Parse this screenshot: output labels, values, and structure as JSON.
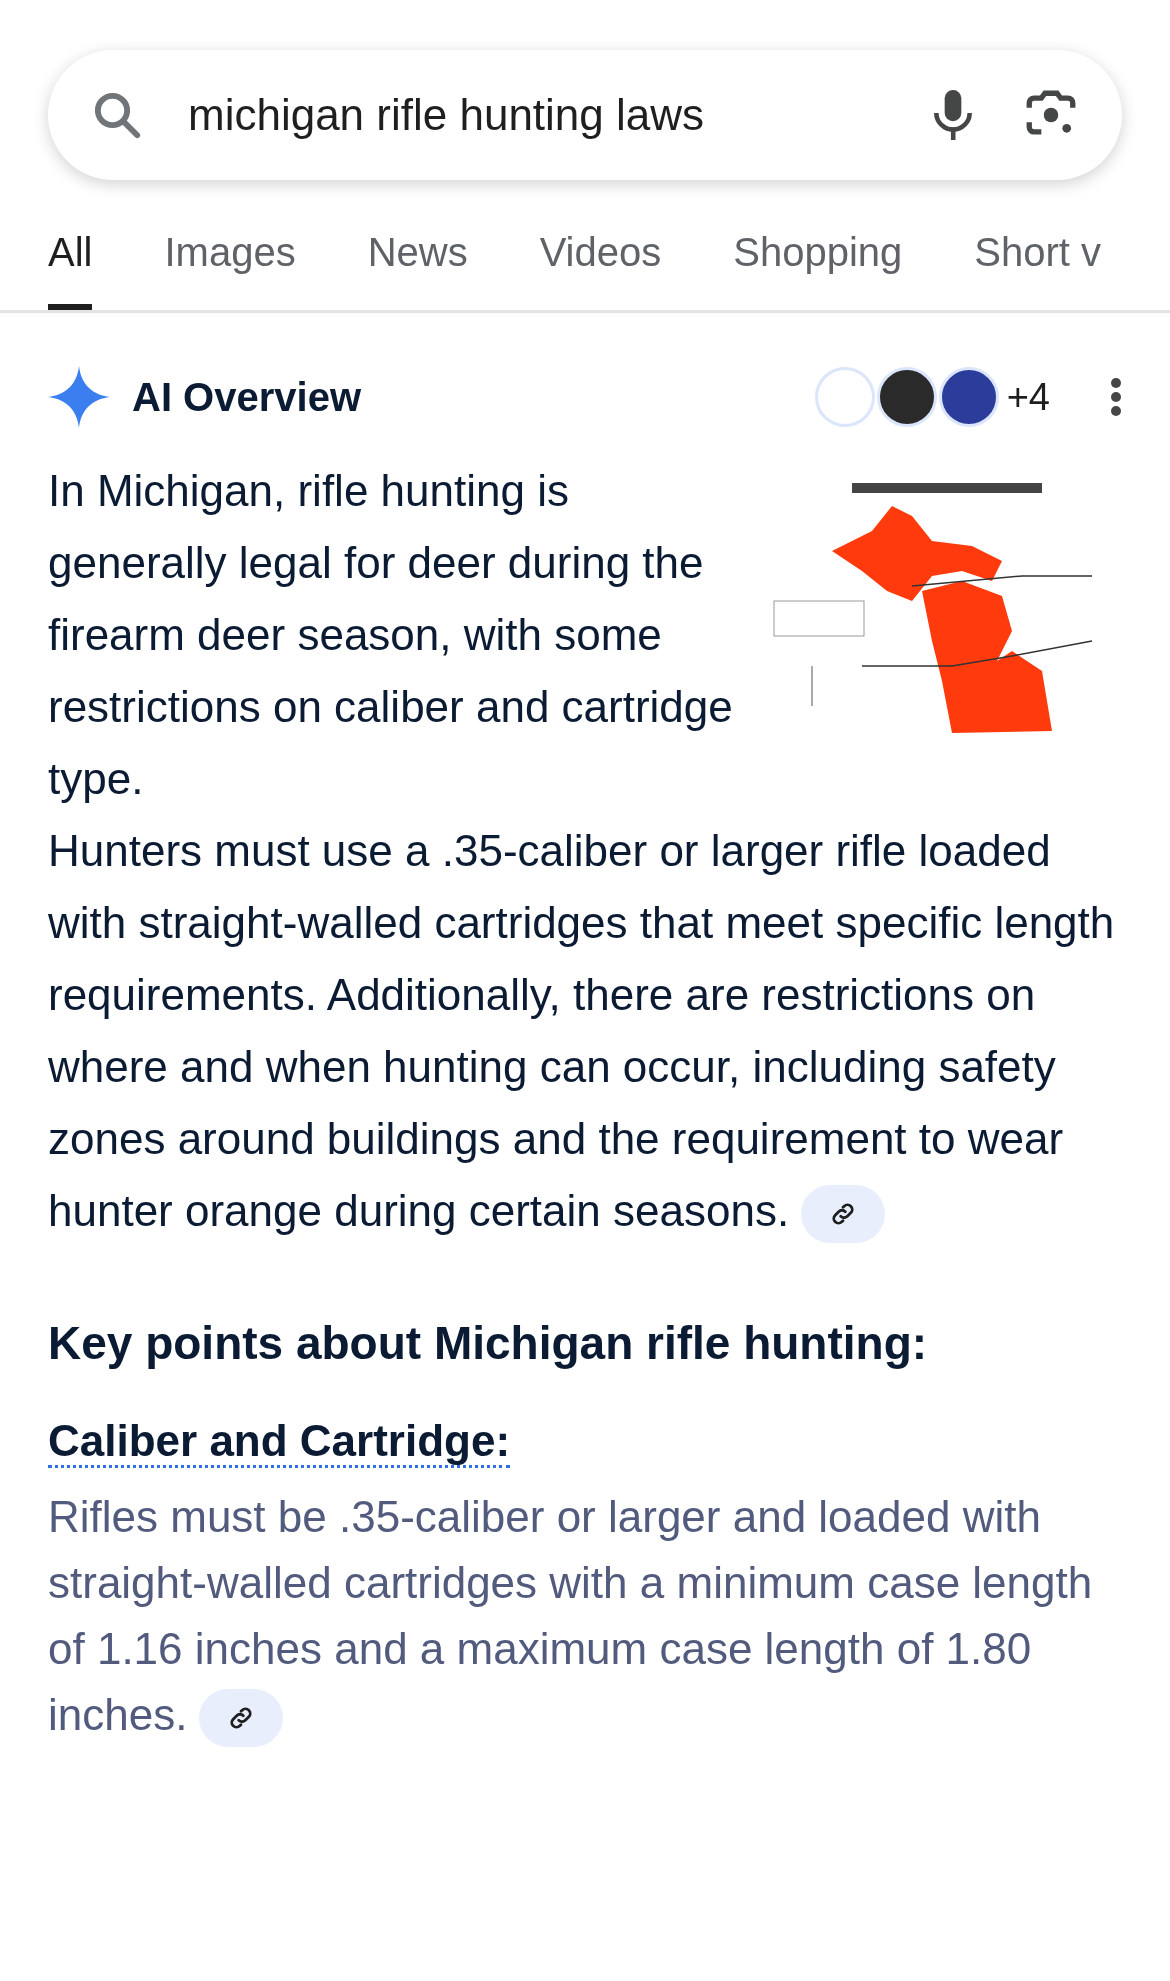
{
  "search": {
    "value": "michigan rifle hunting laws"
  },
  "tabs": [
    {
      "label": "All",
      "selected": true
    },
    {
      "label": "Images",
      "selected": false
    },
    {
      "label": "News",
      "selected": false
    },
    {
      "label": "Videos",
      "selected": false
    },
    {
      "label": "Shopping",
      "selected": false
    },
    {
      "label": "Short v",
      "selected": false
    }
  ],
  "ai_overview": {
    "title": "AI Overview",
    "sources_more": "+4",
    "summary_beside_image": "In Michigan, rifle hunting is generally legal for deer during the firearm deer season, with some restrictions on caliber and cartridge type.",
    "summary": "Hunters must use a .35-caliber or larger rifle loaded with straight-walled cartridges that meet specific length requirements. Additionally, there are restrictions on where and when hunting can occur, including safety zones around buildings and the requirement to wear hunter orange during certain seasons.",
    "key_points_heading": "Key points about Michigan rifle hunting:",
    "key_points": [
      {
        "title": "Caliber and Cartridge:",
        "text": "Rifles must be .35-caliber or larger and loaded with straight-walled cartridges with a minimum case length of 1.16 inches and a maximum case length of 1.80 inches."
      }
    ]
  }
}
